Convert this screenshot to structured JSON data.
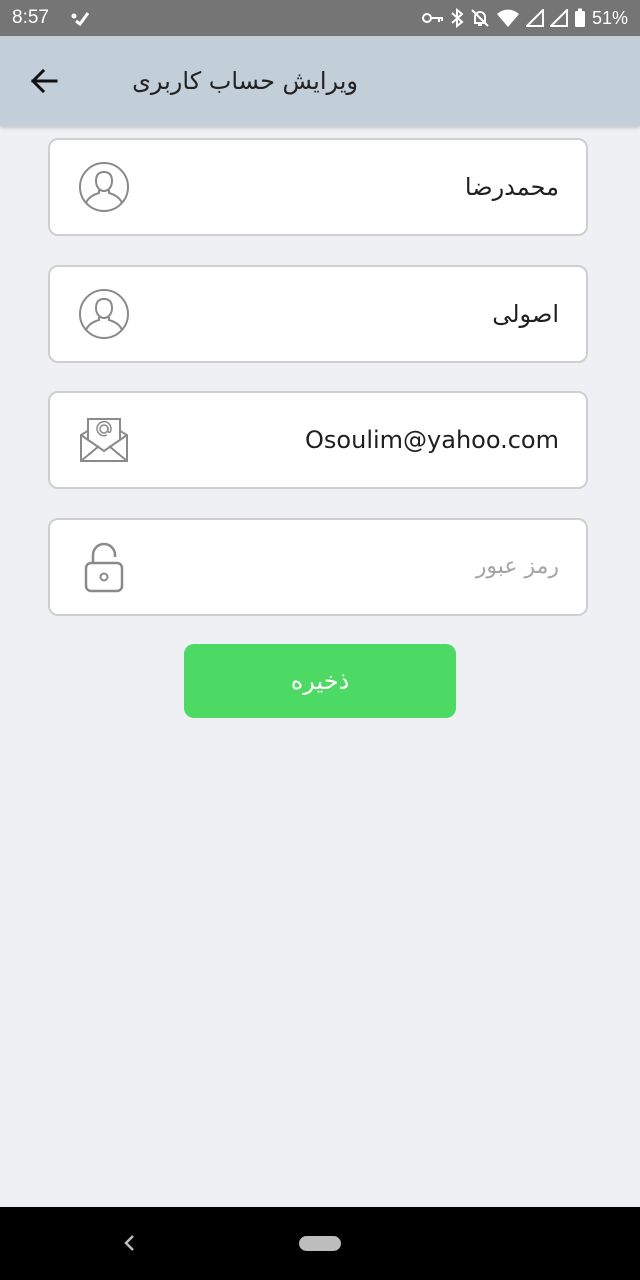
{
  "status_bar": {
    "time": "8:57",
    "battery": "51%",
    "icons": [
      "vpn-key-icon",
      "bluetooth-icon",
      "notifications-off-icon",
      "wifi-icon",
      "signal-icon",
      "signal-icon",
      "battery-icon"
    ]
  },
  "header": {
    "title": "ویرایش حساب کاربری",
    "back_icon": "arrow-back-icon"
  },
  "form": {
    "first_name": {
      "value": "محمدرضا",
      "icon": "user-icon"
    },
    "last_name": {
      "value": "اصولی",
      "icon": "user-icon"
    },
    "email": {
      "value": "Osoulim@yahoo.com",
      "icon": "mail-icon"
    },
    "password": {
      "placeholder": "رمز عبور",
      "value": "",
      "icon": "lock-icon"
    },
    "save_label": "ذخیره"
  },
  "colors": {
    "header_bg": "#c2cfd9",
    "page_bg": "#eff0f4",
    "accent_green": "#4cd964",
    "status_bar_bg": "#757575"
  }
}
